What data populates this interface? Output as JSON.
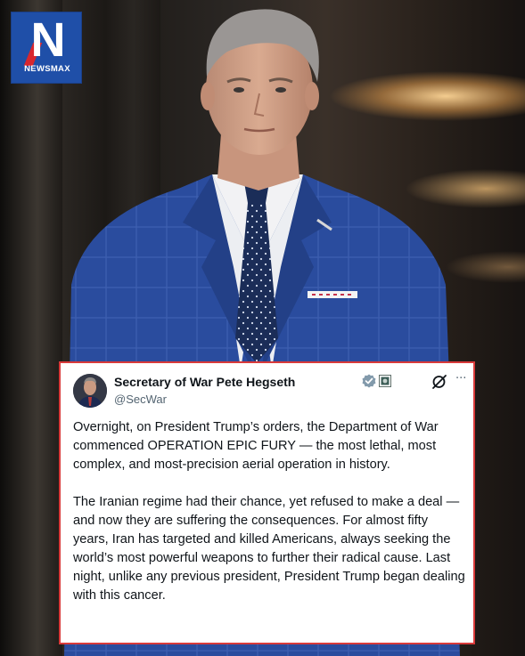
{
  "logo": {
    "letter": "N",
    "wordmark": "NEWSMAX"
  },
  "post": {
    "author": {
      "display_name": "Secretary of War Pete Hegseth",
      "handle": "@SecWar"
    },
    "icons": {
      "verified": "verified-badge-icon",
      "affiliate": "government-affiliate-icon",
      "grok": "grok-icon",
      "more": "more-options-icon"
    },
    "paragraphs": [
      "Overnight, on President Trump’s orders, the Department of War commenced OPERATION EPIC FURY — the most lethal, most complex, and most-precision aerial operation in history.",
      "The Iranian regime had their chance, yet refused to make a deal — and now they are suffering the consequences. For almost fifty years, Iran has targeted and killed Americans, always seeking the world’s most powerful weapons to further their radical cause. Last night, unlike any previous president, President Trump began dealing with this cancer."
    ],
    "more_glyph": "···"
  },
  "colors": {
    "card_border": "#d93a3a",
    "verified": "#829aab",
    "logo_blue": "#1f4fa8",
    "logo_red": "#d7262e",
    "suit": "#24418f"
  }
}
